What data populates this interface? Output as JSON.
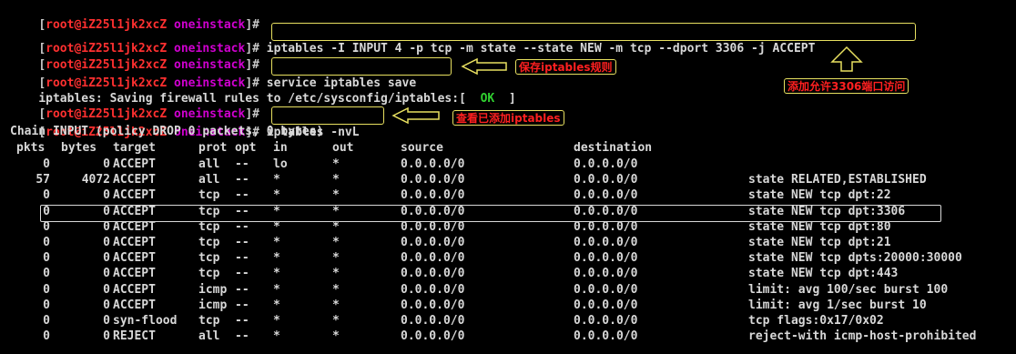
{
  "prompt": {
    "user_host": "root@iZ25l1jk2xcZ",
    "cwd": "oneinstack",
    "open": "[",
    "close": "]#"
  },
  "commands": {
    "add_rule": "iptables -I INPUT 4 -p tcp -m state --state NEW -m tcp --dport 3306 -j ACCEPT",
    "save": "service iptables save",
    "list": "iptables -nvL"
  },
  "save_output": {
    "prefix": "iptables: Saving firewall rules to /etc/sysconfig/iptables:[",
    "status": "OK",
    "suffix": "]"
  },
  "chain_header": "Chain INPUT (policy DROP 0 packets, 0 bytes)",
  "table": {
    "headers": [
      "pkts",
      "bytes",
      "target",
      "prot",
      "opt",
      "in",
      "out",
      "source",
      "destination",
      ""
    ],
    "rows": [
      [
        "0",
        "0",
        "ACCEPT",
        "all",
        "--",
        "lo",
        "*",
        "0.0.0.0/0",
        "0.0.0.0/0",
        ""
      ],
      [
        "57",
        "4072",
        "ACCEPT",
        "all",
        "--",
        "*",
        "*",
        "0.0.0.0/0",
        "0.0.0.0/0",
        "state RELATED,ESTABLISHED"
      ],
      [
        "0",
        "0",
        "ACCEPT",
        "tcp",
        "--",
        "*",
        "*",
        "0.0.0.0/0",
        "0.0.0.0/0",
        "state NEW tcp dpt:22"
      ],
      [
        "0",
        "0",
        "ACCEPT",
        "tcp",
        "--",
        "*",
        "*",
        "0.0.0.0/0",
        "0.0.0.0/0",
        "state NEW tcp dpt:3306"
      ],
      [
        "0",
        "0",
        "ACCEPT",
        "tcp",
        "--",
        "*",
        "*",
        "0.0.0.0/0",
        "0.0.0.0/0",
        "state NEW tcp dpt:80"
      ],
      [
        "0",
        "0",
        "ACCEPT",
        "tcp",
        "--",
        "*",
        "*",
        "0.0.0.0/0",
        "0.0.0.0/0",
        "state NEW tcp dpt:21"
      ],
      [
        "0",
        "0",
        "ACCEPT",
        "tcp",
        "--",
        "*",
        "*",
        "0.0.0.0/0",
        "0.0.0.0/0",
        "state NEW tcp dpts:20000:30000"
      ],
      [
        "0",
        "0",
        "ACCEPT",
        "tcp",
        "--",
        "*",
        "*",
        "0.0.0.0/0",
        "0.0.0.0/0",
        "state NEW tcp dpt:443"
      ],
      [
        "0",
        "0",
        "ACCEPT",
        "icmp",
        "--",
        "*",
        "*",
        "0.0.0.0/0",
        "0.0.0.0/0",
        "limit: avg 100/sec burst 100"
      ],
      [
        "0",
        "0",
        "ACCEPT",
        "icmp",
        "--",
        "*",
        "*",
        "0.0.0.0/0",
        "0.0.0.0/0",
        "limit: avg 1/sec burst 10"
      ],
      [
        "0",
        "0",
        "syn-flood",
        "tcp",
        "--",
        "*",
        "*",
        "0.0.0.0/0",
        "0.0.0.0/0",
        "tcp flags:0x17/0x02"
      ],
      [
        "0",
        "0",
        "REJECT",
        "all",
        "--",
        "*",
        "*",
        "0.0.0.0/0",
        "0.0.0.0/0",
        "reject-with icmp-host-prohibited"
      ]
    ]
  },
  "annotations": {
    "save_note": "保存iptables规则",
    "add_note": "添加允许3306端口访问",
    "list_note": "查看已添加iptables"
  },
  "colors": {
    "background": "#000000",
    "prompt_user": "#ff3030",
    "prompt_dir": "#d000d0",
    "ok": "#30d030",
    "annotation_text": "#ff2020",
    "annotation_border": "#e8e060"
  }
}
